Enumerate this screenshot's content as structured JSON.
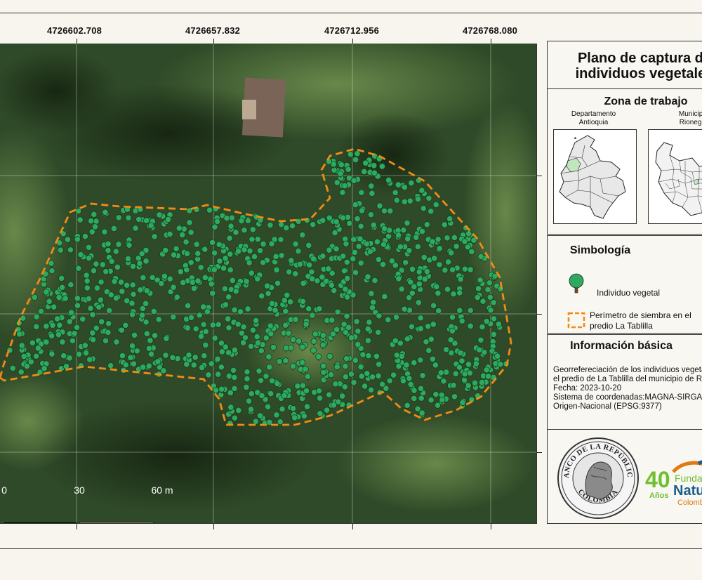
{
  "map": {
    "top_coords": [
      "4726602.708",
      "4726657.832",
      "4726712.956",
      "4726768.080"
    ],
    "scale": {
      "labels": [
        "0",
        "30",
        "60 m"
      ]
    },
    "colors": {
      "perimeter": "#f08c16",
      "tree": "#2fa860",
      "background": "#2f4a28"
    }
  },
  "title": {
    "line1": "Plano de captura de",
    "line2": "individuos vegetales"
  },
  "zona": {
    "title": "Zona de trabajo",
    "left_label_1": "Departamento",
    "left_label_2": "Antioquia",
    "right_label_1": "Municipio",
    "right_label_2": "Rionegro"
  },
  "simbologia": {
    "title": "Simbología",
    "tree_label": "Individuo vegetal",
    "perimeter_line1": "Perímetro de siembra en el",
    "perimeter_line2": "predio La Tablilla"
  },
  "info": {
    "title": "Información básica",
    "line1": "Georrefereciación de los individuos vegetales en",
    "line2": "el predio de La Tablilla del municipio de Rionegro",
    "line3": "Fecha: 2023-10-20",
    "line4": "Sistema de coordenadas:MAGNA-SIRGAS/",
    "line5": "Origen-Nacional (EPSG:9377)"
  },
  "logos": {
    "bank_top": "BANCO DE LA REPÚBLICA",
    "bank_bottom": "COLOMBIA",
    "n40": "40",
    "anos": "Años",
    "fund": "Fundación",
    "natura": "Natura",
    "colombia": "Colombia"
  }
}
